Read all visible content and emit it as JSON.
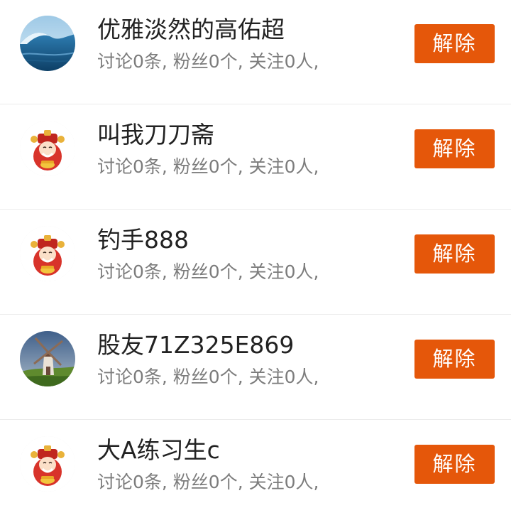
{
  "colors": {
    "accent": "#e5570a",
    "name_text": "#222222",
    "stats_text": "#7c7c7c",
    "divider": "#ececec"
  },
  "users": [
    {
      "name": "优雅淡然的高佑超",
      "stats": "讨论0条, 粉丝0个, 关注0人,",
      "avatar": "ocean-wave-photo",
      "action_label": "解除"
    },
    {
      "name": "叫我刀刀斋",
      "stats": "讨论0条, 粉丝0个, 关注0人,",
      "avatar": "god-of-wealth-cartoon",
      "action_label": "解除"
    },
    {
      "name": "钓手888",
      "stats": "讨论0条, 粉丝0个, 关注0人,",
      "avatar": "god-of-wealth-cartoon",
      "action_label": "解除"
    },
    {
      "name": "股友71Z325E869",
      "stats": "讨论0条, 粉丝0个, 关注0人,",
      "avatar": "windmill-photo",
      "action_label": "解除"
    },
    {
      "name": "大A练习生c",
      "stats": "讨论0条, 粉丝0个, 关注0人,",
      "avatar": "god-of-wealth-cartoon",
      "action_label": "解除"
    }
  ]
}
